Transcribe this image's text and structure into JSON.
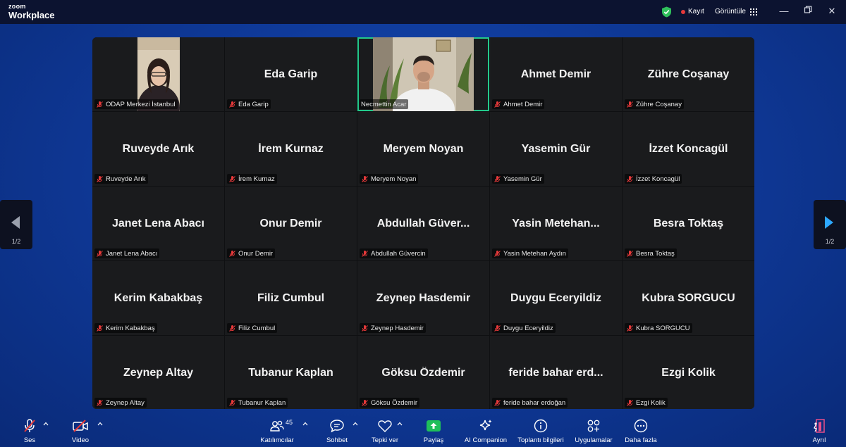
{
  "app": {
    "logo_small": "zoom",
    "logo_big": "Workplace",
    "recording_label": "Kayıt",
    "view_label": "Görüntüle"
  },
  "pager": {
    "left": "1/2",
    "right": "1/2"
  },
  "participants": [
    {
      "big": "",
      "label": "ODAP Merkezi İstanbul"
    },
    {
      "big": "Eda Garip",
      "label": "Eda Garip"
    },
    {
      "big": "",
      "label": "Necmettin Acar"
    },
    {
      "big": "Ahmet Demir",
      "label": "Ahmet Demir"
    },
    {
      "big": "Zühre Coşanay",
      "label": "Zühre Coşanay"
    },
    {
      "big": "Ruveyde Arık",
      "label": "Ruveyde Arık"
    },
    {
      "big": "İrem Kurnaz",
      "label": "İrem Kurnaz"
    },
    {
      "big": "Meryem Noyan",
      "label": "Meryem Noyan"
    },
    {
      "big": "Yasemin Gür",
      "label": "Yasemin Gür"
    },
    {
      "big": "İzzet Koncagül",
      "label": "İzzet Koncagül"
    },
    {
      "big": "Janet Lena Abacı",
      "label": "Janet Lena Abacı"
    },
    {
      "big": "Onur Demir",
      "label": "Onur Demir"
    },
    {
      "big": "Abdullah  Güver...",
      "label": "Abdullah Güvercin"
    },
    {
      "big": "Yasin  Metehan...",
      "label": "Yasin Metehan Aydın"
    },
    {
      "big": "Besra Toktaş",
      "label": "Besra Toktaş"
    },
    {
      "big": "Kerim Kabakbaş",
      "label": "Kerim Kabakbaş"
    },
    {
      "big": "Filiz Cumbul",
      "label": "Filiz Cumbul"
    },
    {
      "big": "Zeynep Hasdemir",
      "label": "Zeynep Hasdemir"
    },
    {
      "big": "Duygu Eceryildiz",
      "label": "Duygu Eceryildiz"
    },
    {
      "big": "Kubra SORGUCU",
      "label": "Kubra SORGUCU"
    },
    {
      "big": "Zeynep Altay",
      "label": "Zeynep Altay"
    },
    {
      "big": "Tubanur Kaplan",
      "label": "Tubanur Kaplan"
    },
    {
      "big": "Göksu Özdemir",
      "label": "Göksu Özdemir"
    },
    {
      "big": "feride bahar erd...",
      "label": "feride bahar erdoğan"
    },
    {
      "big": "Ezgi Kolik",
      "label": "Ezgi Kolik"
    }
  ],
  "toolbar": {
    "audio": "Ses",
    "video": "Video",
    "participants": "Katılımcılar",
    "participants_count": "45",
    "chat": "Sohbet",
    "react": "Tepki ver",
    "share": "Paylaş",
    "ai": "AI Companion",
    "info": "Toplantı bilgileri",
    "apps": "Uygulamalar",
    "more": "Daha fazla",
    "leave": "Ayrıl"
  },
  "colors": {
    "active_speaker": "#23c98b",
    "share_green": "#1fbf5a",
    "recording_red": "#e5393a",
    "leave_pink": "#e84f8a",
    "muted_red": "#e5393a"
  }
}
